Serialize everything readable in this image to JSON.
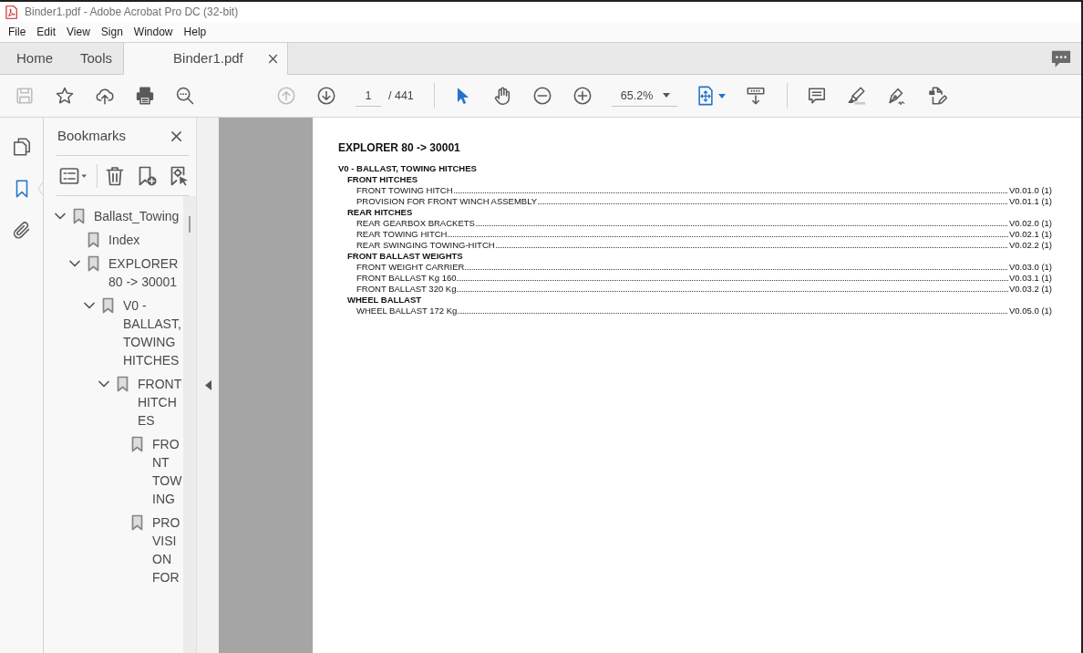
{
  "window": {
    "title": "Binder1.pdf - Adobe Acrobat Pro DC (32-bit)"
  },
  "menu": [
    "File",
    "Edit",
    "View",
    "Sign",
    "Window",
    "Help"
  ],
  "tabs": [
    {
      "label": "Home",
      "selected": false,
      "closable": false
    },
    {
      "label": "Tools",
      "selected": false,
      "closable": false
    },
    {
      "label": "Binder1.pdf",
      "selected": true,
      "closable": true
    }
  ],
  "toolbar": {
    "save": {
      "disabled": true
    },
    "previous_page": {
      "disabled": true
    },
    "next_page": {
      "disabled": false
    },
    "page_field": {
      "value": "1"
    },
    "page_total": "/ 441",
    "select_tool": {
      "selected": true
    },
    "hand_tool": {
      "selected": false
    },
    "zoom_field": {
      "value": "65.2%"
    }
  },
  "nav_rail": {
    "pages": {
      "selected": false
    },
    "bookmarks": {
      "selected": true
    },
    "attachments": {
      "selected": false
    }
  },
  "bookmarks_panel": {
    "title": "Bookmarks",
    "tree": [
      {
        "label": "Ballast_Towing",
        "expanded": true,
        "children": [
          {
            "label": "Index"
          },
          {
            "label": "EXPLORER 80 -> 30001",
            "expanded": true,
            "children": [
              {
                "label": "V0 - BALLAST, TOWING HITCHES",
                "expanded": true,
                "children": [
                  {
                    "label": "FRONT HITCHES",
                    "expanded": true,
                    "children": [
                      {
                        "label": "FRONT TOWING"
                      },
                      {
                        "label": "PROVISION FOR"
                      }
                    ]
                  }
                ]
              }
            ]
          }
        ]
      }
    ]
  },
  "document": {
    "title": "EXPLORER 80 -> 30001",
    "sections": [
      {
        "heading": "V0 - BALLAST, TOWING HITCHES",
        "groups": [
          {
            "heading": "FRONT HITCHES",
            "entries": [
              {
                "label": "FRONT TOWING HITCH",
                "ref": "V0.01.0 (1)"
              },
              {
                "label": "PROVISION FOR FRONT WINCH ASSEMBLY",
                "ref": "V0.01.1 (1)"
              }
            ]
          },
          {
            "heading": "REAR HITCHES",
            "entries": [
              {
                "label": "REAR GEARBOX BRACKETS",
                "ref": "V0.02.0 (1)"
              },
              {
                "label": "REAR TOWING HITCH",
                "ref": "V0.02.1 (1)"
              },
              {
                "label": "REAR SWINGING TOWING-HITCH",
                "ref": "V0.02.2 (1)"
              }
            ]
          },
          {
            "heading": "FRONT BALLAST WEIGHTS",
            "entries": [
              {
                "label": "FRONT WEIGHT CARRIER",
                "ref": "V0.03.0 (1)"
              },
              {
                "label": "FRONT BALLAST Kg 160",
                "ref": "V0.03.1 (1)"
              },
              {
                "label": "FRONT BALLAST 320 Kg",
                "ref": "V0.03.2 (1)"
              }
            ]
          },
          {
            "heading": "WHEEL BALLAST",
            "entries": [
              {
                "label": "WHEEL BALLAST 172 Kg",
                "ref": "V0.05.0 (1)"
              }
            ]
          }
        ]
      }
    ]
  }
}
